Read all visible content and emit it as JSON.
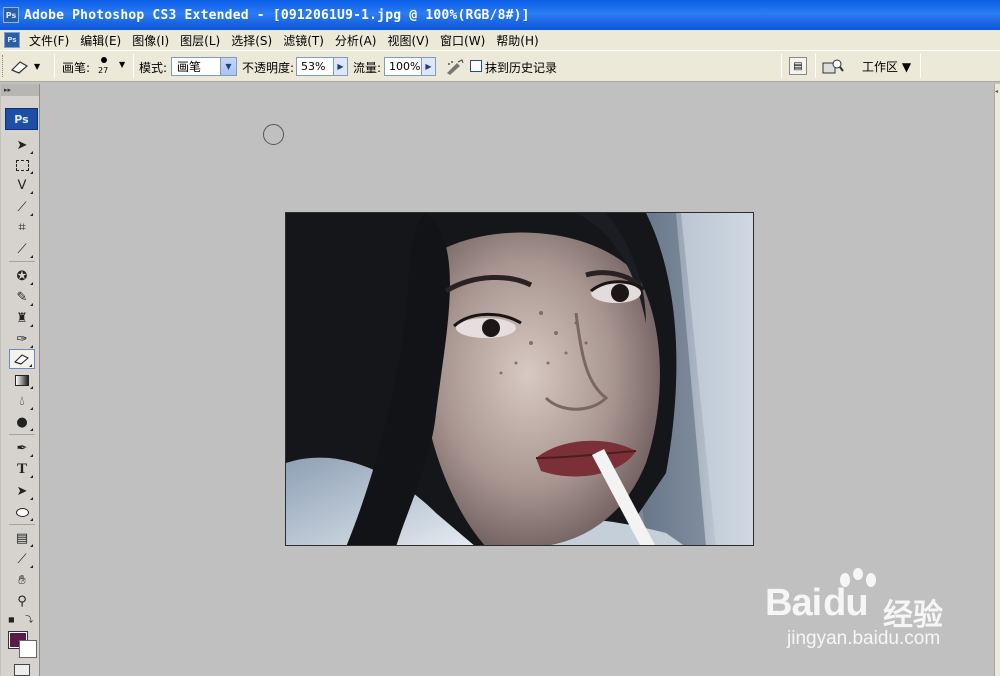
{
  "window": {
    "title": "Adobe Photoshop CS3 Extended - [0912061U9-1.jpg @ 100%(RGB/8#)]",
    "icon_label": "Ps"
  },
  "menubar": {
    "items": [
      "文件(F)",
      "编辑(E)",
      "图像(I)",
      "图层(L)",
      "选择(S)",
      "滤镜(T)",
      "分析(A)",
      "视图(V)",
      "窗口(W)",
      "帮助(H)"
    ]
  },
  "options": {
    "brush_label": "画笔:",
    "brush_size": "27",
    "mode_label": "模式:",
    "mode_value": "画笔",
    "opacity_label": "不透明度:",
    "opacity_value": "53%",
    "flow_label": "流量:",
    "flow_value": "100%",
    "erase_history_label": "抹到历史记录",
    "erase_history_checked": false,
    "workspace_label": "工作区 ▼"
  },
  "toolbox": {
    "logo": "Ps",
    "active_tool": "eraser",
    "foreground_color": "#5a1a4a",
    "background_color": "#ffffff",
    "tools": [
      "move",
      "marquee",
      "lasso",
      "magic-wand",
      "crop",
      "slice",
      "healing-brush",
      "brush",
      "clone-stamp",
      "history-brush",
      "eraser",
      "gradient",
      "blur",
      "dodge",
      "pen",
      "type",
      "path-selection",
      "shape",
      "notes",
      "eyedropper",
      "hand",
      "zoom"
    ]
  },
  "document": {
    "zoom": "100%"
  },
  "watermark": {
    "main": "Bai",
    "main2": "du",
    "cn": "经验",
    "sub": "jingyan.baidu.com"
  }
}
